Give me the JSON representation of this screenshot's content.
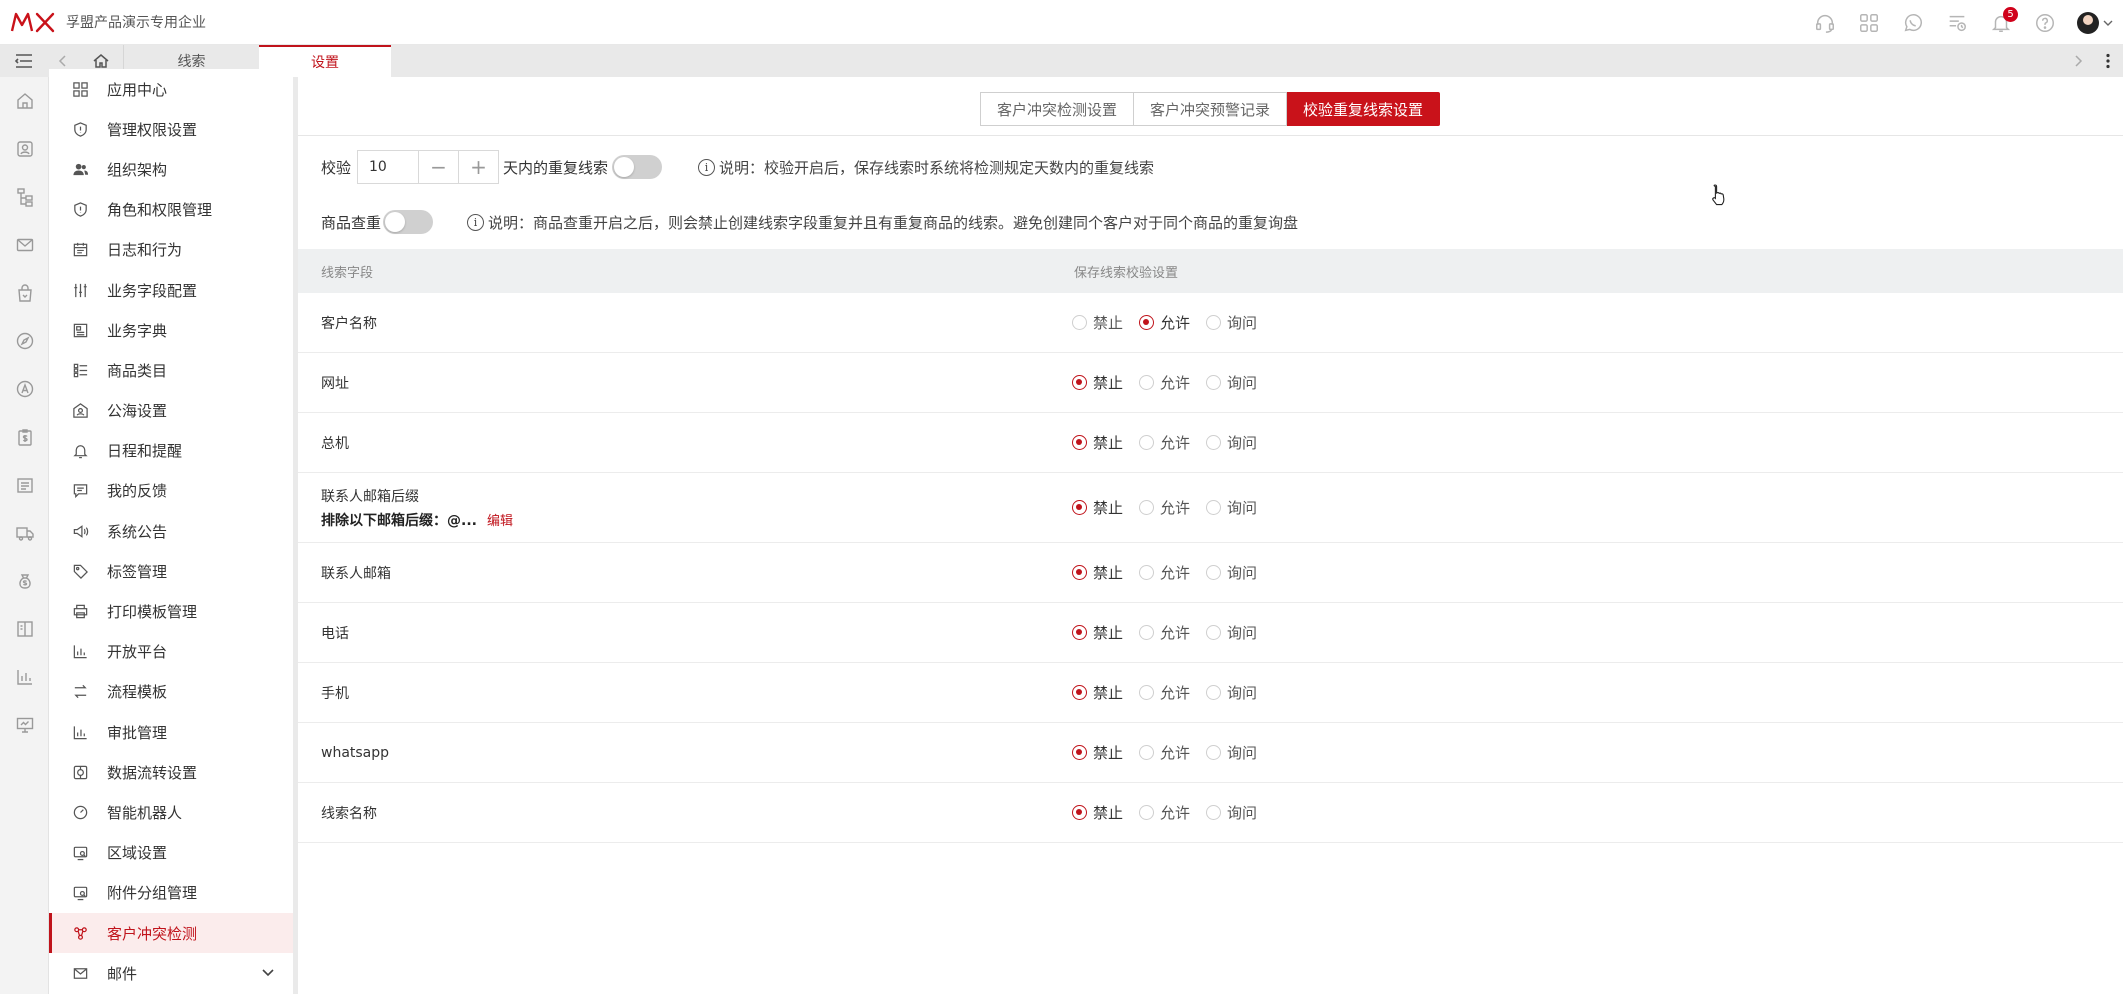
{
  "header": {
    "company": "孚盟产品演示专用企业",
    "notification_count": "5",
    "icons": [
      "headset-icon",
      "apps-grid-icon",
      "whatsapp-icon",
      "task-list-icon",
      "bell-icon",
      "help-icon",
      "avatar"
    ]
  },
  "tabs": {
    "items": [
      {
        "label": "线索",
        "active": false
      },
      {
        "label": "设置",
        "active": true
      }
    ]
  },
  "sidebar": {
    "items": [
      {
        "label": "应用中心",
        "icon": "apps-icon"
      },
      {
        "label": "管理权限设置",
        "icon": "shield-icon"
      },
      {
        "label": "组织架构",
        "icon": "people-icon"
      },
      {
        "label": "角色和权限管理",
        "icon": "shield-icon"
      },
      {
        "label": "日志和行为",
        "icon": "calendar-icon"
      },
      {
        "label": "业务字段配置",
        "icon": "sliders-icon"
      },
      {
        "label": "业务字典",
        "icon": "dictionary-icon"
      },
      {
        "label": "商品类目",
        "icon": "list-icon"
      },
      {
        "label": "公海设置",
        "icon": "sea-icon"
      },
      {
        "label": "日程和提醒",
        "icon": "bell-icon"
      },
      {
        "label": "我的反馈",
        "icon": "feedback-icon"
      },
      {
        "label": "系统公告",
        "icon": "megaphone-icon"
      },
      {
        "label": "标签管理",
        "icon": "tag-icon"
      },
      {
        "label": "打印模板管理",
        "icon": "printer-icon"
      },
      {
        "label": "开放平台",
        "icon": "bar-chart-icon"
      },
      {
        "label": "流程模板",
        "icon": "flow-icon"
      },
      {
        "label": "审批管理",
        "icon": "bar-chart-icon"
      },
      {
        "label": "数据流转设置",
        "icon": "data-flow-icon"
      },
      {
        "label": "智能机器人",
        "icon": "gauge-icon"
      },
      {
        "label": "区域设置",
        "icon": "region-icon"
      },
      {
        "label": "附件分组管理",
        "icon": "folder-icon"
      },
      {
        "label": "客户冲突检测",
        "icon": "conflict-icon",
        "active": true
      },
      {
        "label": "邮件",
        "icon": "mail-icon",
        "expandable": true
      }
    ]
  },
  "segments": {
    "items": [
      {
        "label": "客户冲突检测设置",
        "active": false
      },
      {
        "label": "客户冲突预警记录",
        "active": false
      },
      {
        "label": "校验重复线索设置",
        "active": true
      }
    ]
  },
  "check": {
    "label_prefix": "校验",
    "days": "10",
    "minus": "−",
    "plus": "+",
    "label_suffix": "天内的重复线索",
    "enabled": false,
    "note": "说明：校验开启后，保存线索时系统将检测规定天数内的重复线索"
  },
  "goods": {
    "label": "商品查重",
    "enabled": false,
    "note": "说明：商品查重开启之后，则会禁止创建线索字段重复并且有重复商品的线索。避免创建同个客户对于同个商品的重复询盘"
  },
  "table": {
    "col_field": "线索字段",
    "col_setting": "保存线索校验设置",
    "options": [
      "禁止",
      "允许",
      "询问"
    ],
    "rows": [
      {
        "field": "客户名称",
        "selected": 1
      },
      {
        "field": "网址",
        "selected": 0
      },
      {
        "field": "总机",
        "selected": 0
      },
      {
        "field": "联系人邮箱后缀",
        "sub": "排除以下邮箱后缀：@...",
        "edit": "编辑",
        "selected": 0
      },
      {
        "field": "联系人邮箱",
        "selected": 0
      },
      {
        "field": "电话",
        "selected": 0
      },
      {
        "field": "手机",
        "selected": 0
      },
      {
        "field": "whatsapp",
        "selected": 0
      },
      {
        "field": "线索名称",
        "selected": 0
      }
    ]
  },
  "colors": {
    "accent": "#c9121a",
    "rail_bg": "#f3f3f3",
    "table_header_bg": "#eef0f1"
  }
}
